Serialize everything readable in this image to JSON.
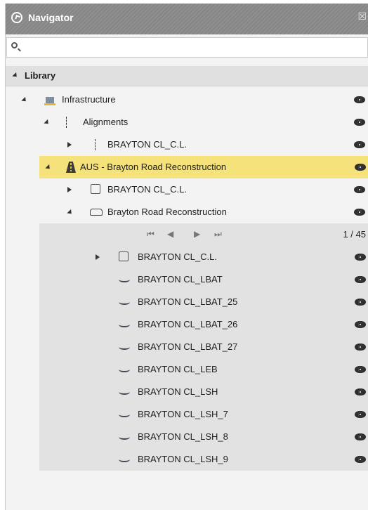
{
  "window": {
    "title": "Navigator",
    "close_glyph": "☒"
  },
  "search": {
    "placeholder": "",
    "value": ""
  },
  "library": {
    "label": "Library"
  },
  "tree": {
    "infrastructure": "Infrastructure",
    "alignments": "Alignments",
    "alignment_brayton": "BRAYTON CL_C.L.",
    "aus_model": "AUS - Brayton Road Reconstruction",
    "aus_brayton": "BRAYTON CL_C.L.",
    "road_reconstruction": "Brayton Road Reconstruction"
  },
  "pager": {
    "first": "⏮",
    "prev": "◀",
    "next": "▶",
    "last": "⏭",
    "count": "1 / 45"
  },
  "items": [
    "BRAYTON CL_C.L.",
    "BRAYTON CL_LBAT",
    "BRAYTON CL_LBAT_25",
    "BRAYTON CL_LBAT_26",
    "BRAYTON CL_LBAT_27",
    "BRAYTON CL_LEB",
    "BRAYTON CL_LSH",
    "BRAYTON CL_LSH_7",
    "BRAYTON CL_LSH_8",
    "BRAYTON CL_LSH_9"
  ],
  "colors": {
    "highlight": "#f6e27a",
    "titlebar": "#8a8a8a",
    "subpanel": "#e2e2e2"
  },
  "icons": [
    "navigator-icon",
    "close-icon",
    "search-icon",
    "infrastructure-icon",
    "alignment-icon",
    "road-icon",
    "road-model-icon",
    "curve-icon",
    "eye-icon"
  ]
}
